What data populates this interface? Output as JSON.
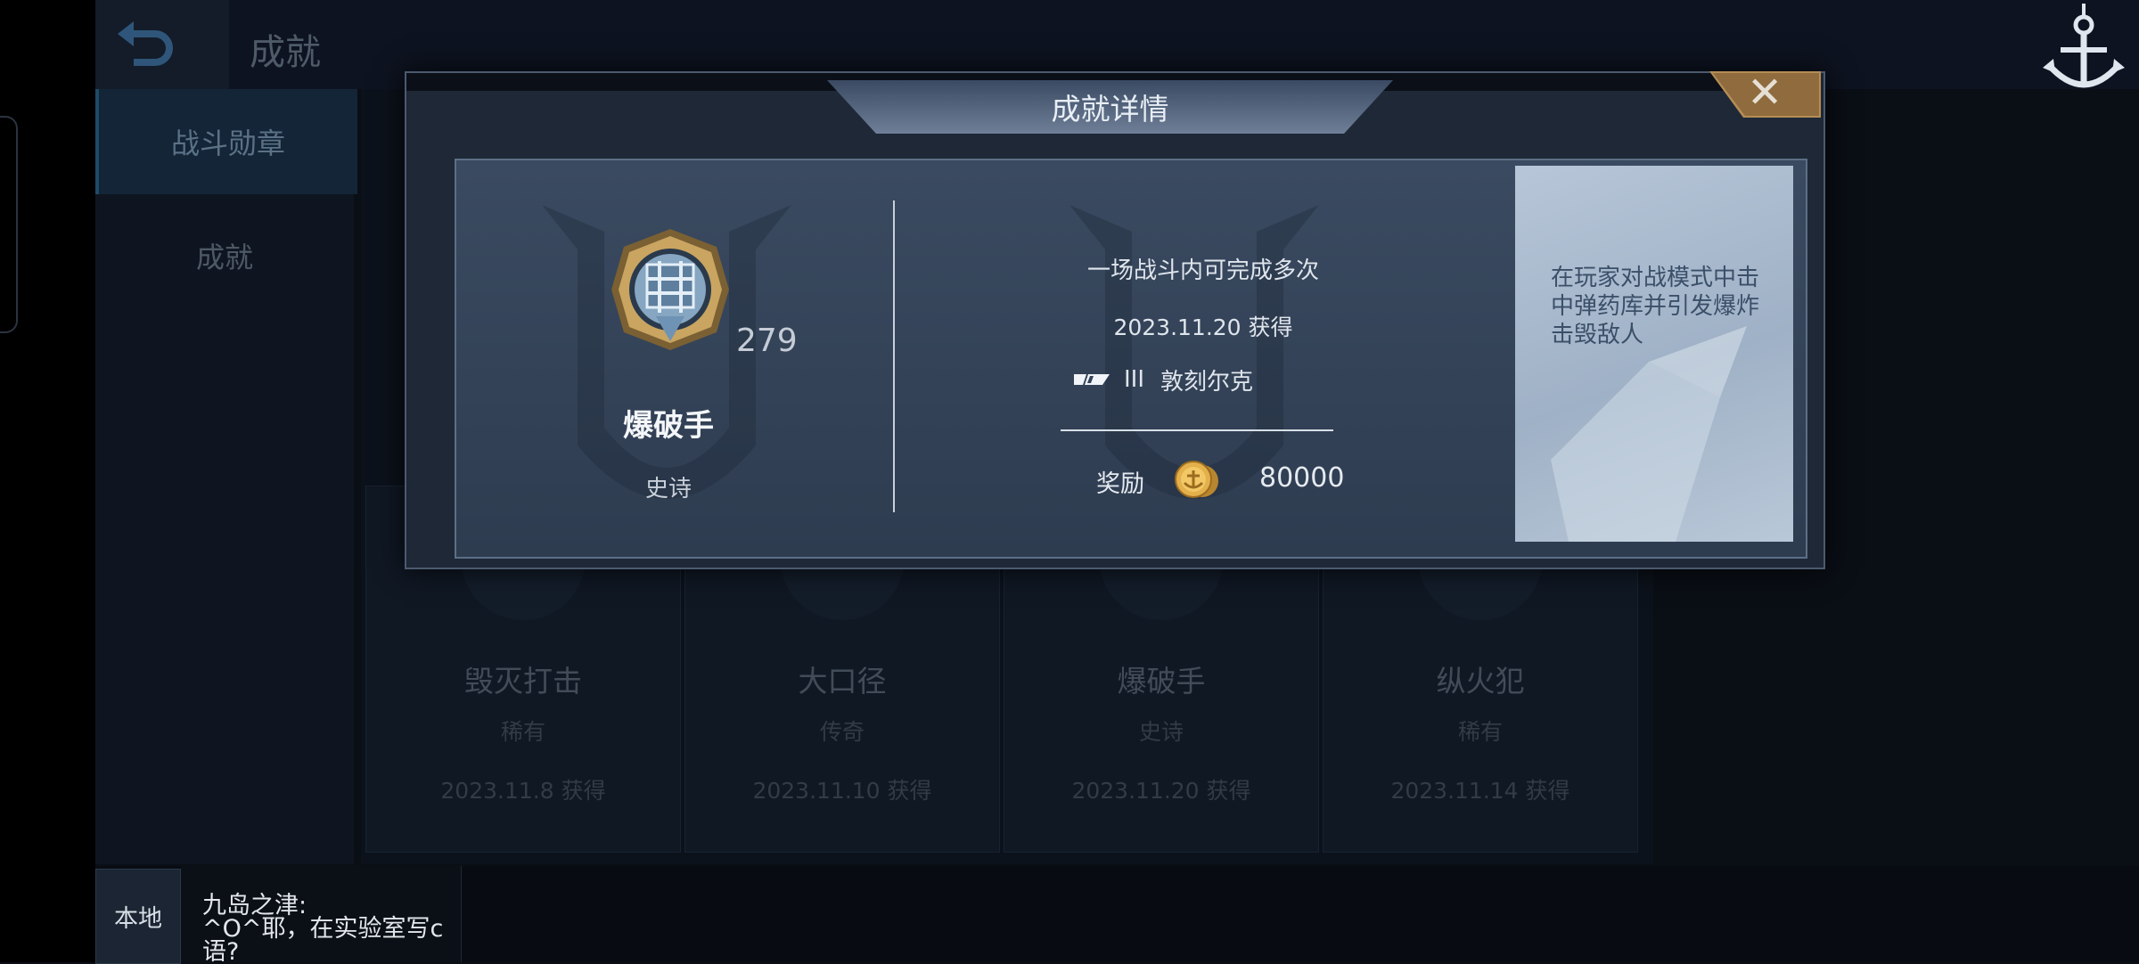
{
  "header": {
    "title": "成就",
    "back_icon": "back-arrow-icon"
  },
  "sidebar": {
    "items": [
      {
        "label": "战斗勋章",
        "active": true
      },
      {
        "label": "成就",
        "active": false
      }
    ]
  },
  "cards": [
    {
      "name": "毁灭打击",
      "rarity": "稀有",
      "date": "2023.11.8 获得"
    },
    {
      "name": "大口径",
      "rarity": "传奇",
      "date": "2023.11.10 获得"
    },
    {
      "name": "爆破手",
      "rarity": "史诗",
      "date": "2023.11.20 获得"
    },
    {
      "name": "纵火犯",
      "rarity": "稀有",
      "date": "2023.11.14 获得"
    }
  ],
  "modal": {
    "title": "成就详情",
    "close_icon": "close-icon",
    "achievement": {
      "name": "爆破手",
      "rarity": "史诗",
      "count": "279"
    },
    "detail": {
      "repeatable": "一场战斗内可完成多次",
      "obtained": "2023.11.20 获得",
      "ship_tier": "III",
      "ship_name": "敦刻尔克",
      "reward_label": "奖励",
      "reward_value": "80000"
    },
    "description": "在玩家对战模式中击中弹药库并引发爆炸击毁敌人"
  },
  "chat": {
    "channel": "本地",
    "sender": "九岛之津:",
    "line1": "^O^耶，在实验室写c",
    "line2": "语?"
  },
  "colors": {
    "panel": "#344359",
    "accent_gold": "#b38a4e",
    "text": "#dfe5ec"
  }
}
